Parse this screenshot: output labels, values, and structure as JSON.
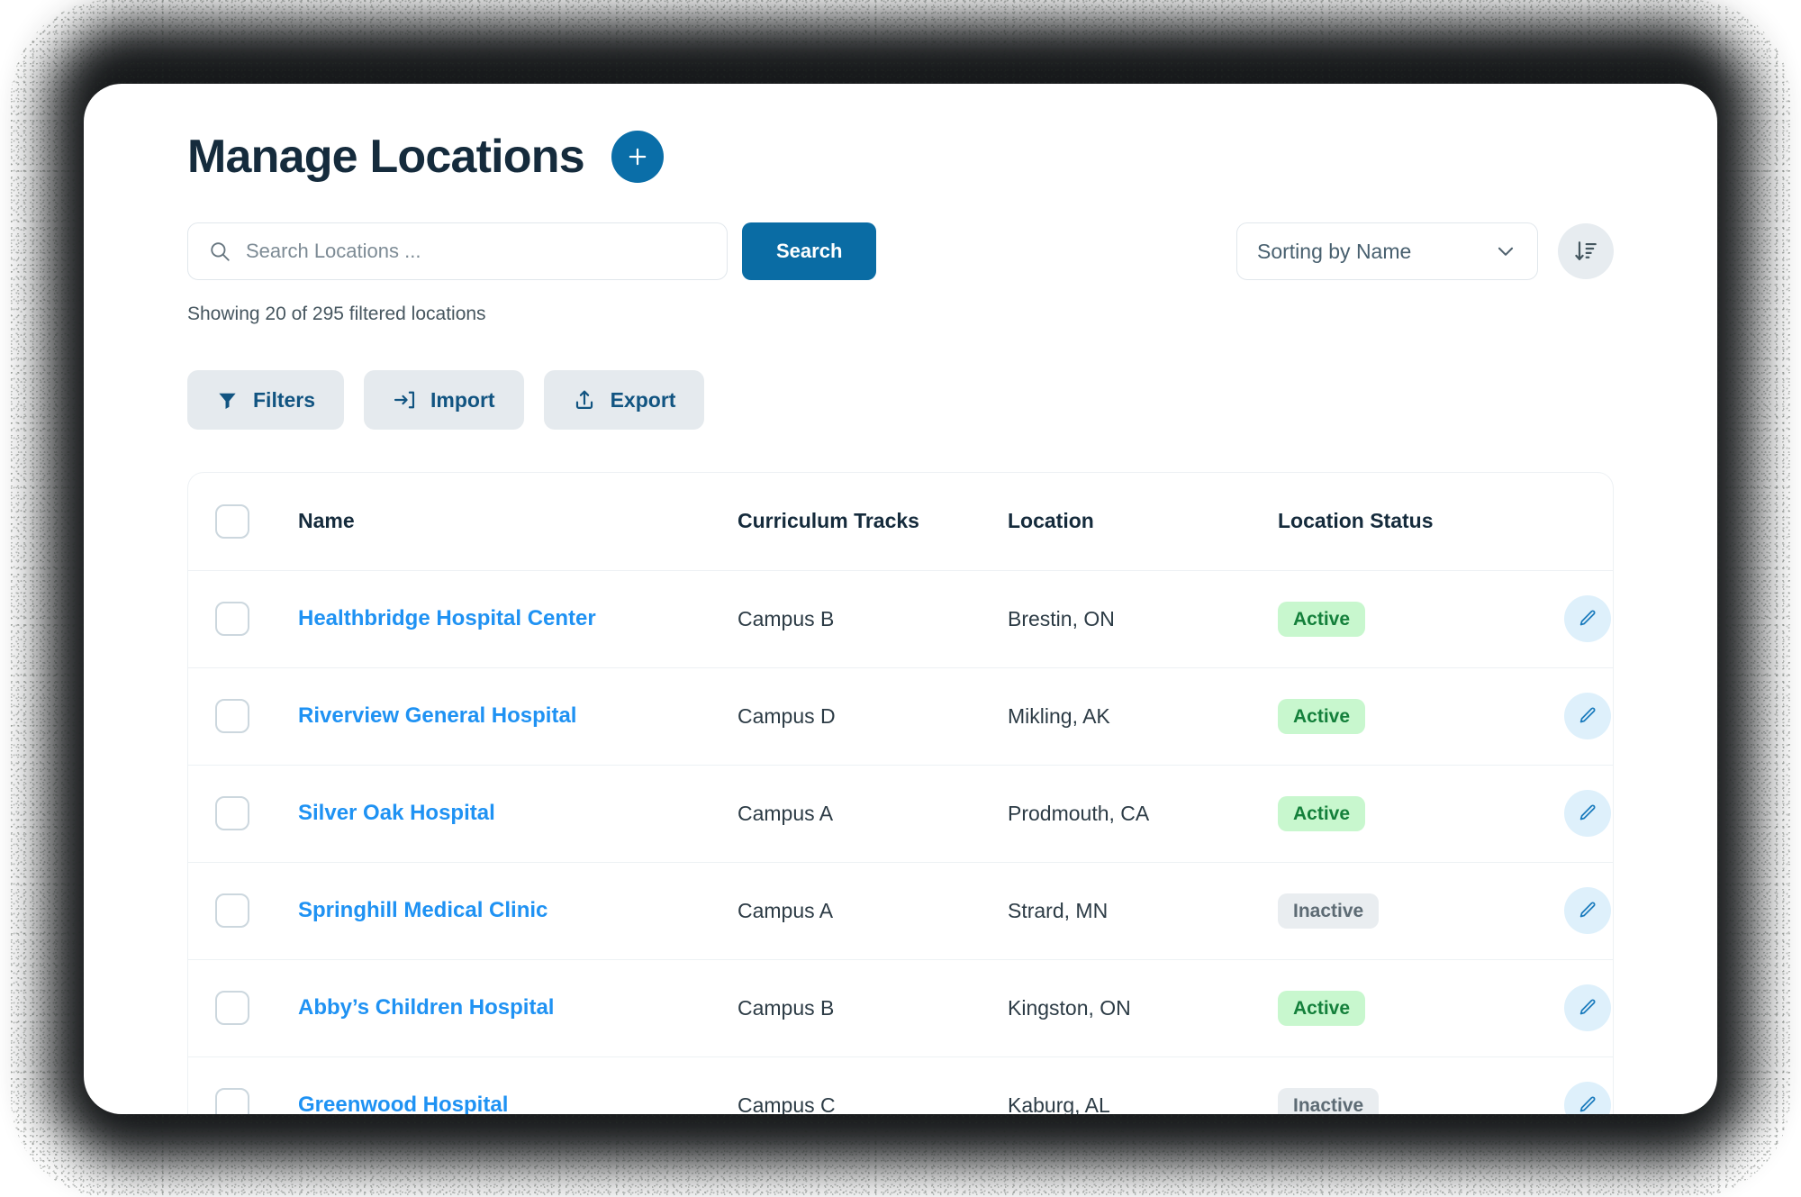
{
  "header": {
    "title": "Manage Locations",
    "add_button_label": "+"
  },
  "search": {
    "placeholder": "Search Locations ...",
    "value": "",
    "submit_label": "Search"
  },
  "sorting": {
    "selected": "Sorting by Name",
    "options": [
      "Sorting by Name"
    ]
  },
  "summary": {
    "text": "Showing 20 of 295 filtered locations"
  },
  "actions": [
    {
      "label": "Filters",
      "icon": "filter-icon"
    },
    {
      "label": "Import",
      "icon": "import-icon"
    },
    {
      "label": "Export",
      "icon": "export-icon"
    }
  ],
  "table": {
    "columns": [
      "Name",
      "Curriculum Tracks",
      "Location",
      "Location Status"
    ],
    "rows": [
      {
        "name": "Healthbridge Hospital Center",
        "track": "Campus B",
        "location": "Brestin, ON",
        "status": "Active"
      },
      {
        "name": "Riverview General Hospital",
        "track": "Campus D",
        "location": "Mikling, AK",
        "status": "Active"
      },
      {
        "name": "Silver Oak Hospital",
        "track": "Campus A",
        "location": "Prodmouth, CA",
        "status": "Active"
      },
      {
        "name": "Springhill Medical Clinic",
        "track": "Campus A",
        "location": "Strard, MN",
        "status": "Inactive"
      },
      {
        "name": "Abby’s Children Hospital",
        "track": "Campus B",
        "location": "Kingston, ON",
        "status": "Active"
      },
      {
        "name": "Greenwood Hospital",
        "track": "Campus C",
        "location": "Kaburg, AL",
        "status": "Inactive"
      }
    ]
  },
  "colors": {
    "brand_blue": "#0a6ca4",
    "title_navy": "#152b3c",
    "link_blue": "#1f92f3",
    "active_bg": "#c8f7ce",
    "active_text": "#14803b",
    "inactive_bg": "#e9edf0",
    "inactive_text": "#5d6b74",
    "action_btn_bg": "#e5eaee",
    "action_btn_text": "#115481"
  }
}
